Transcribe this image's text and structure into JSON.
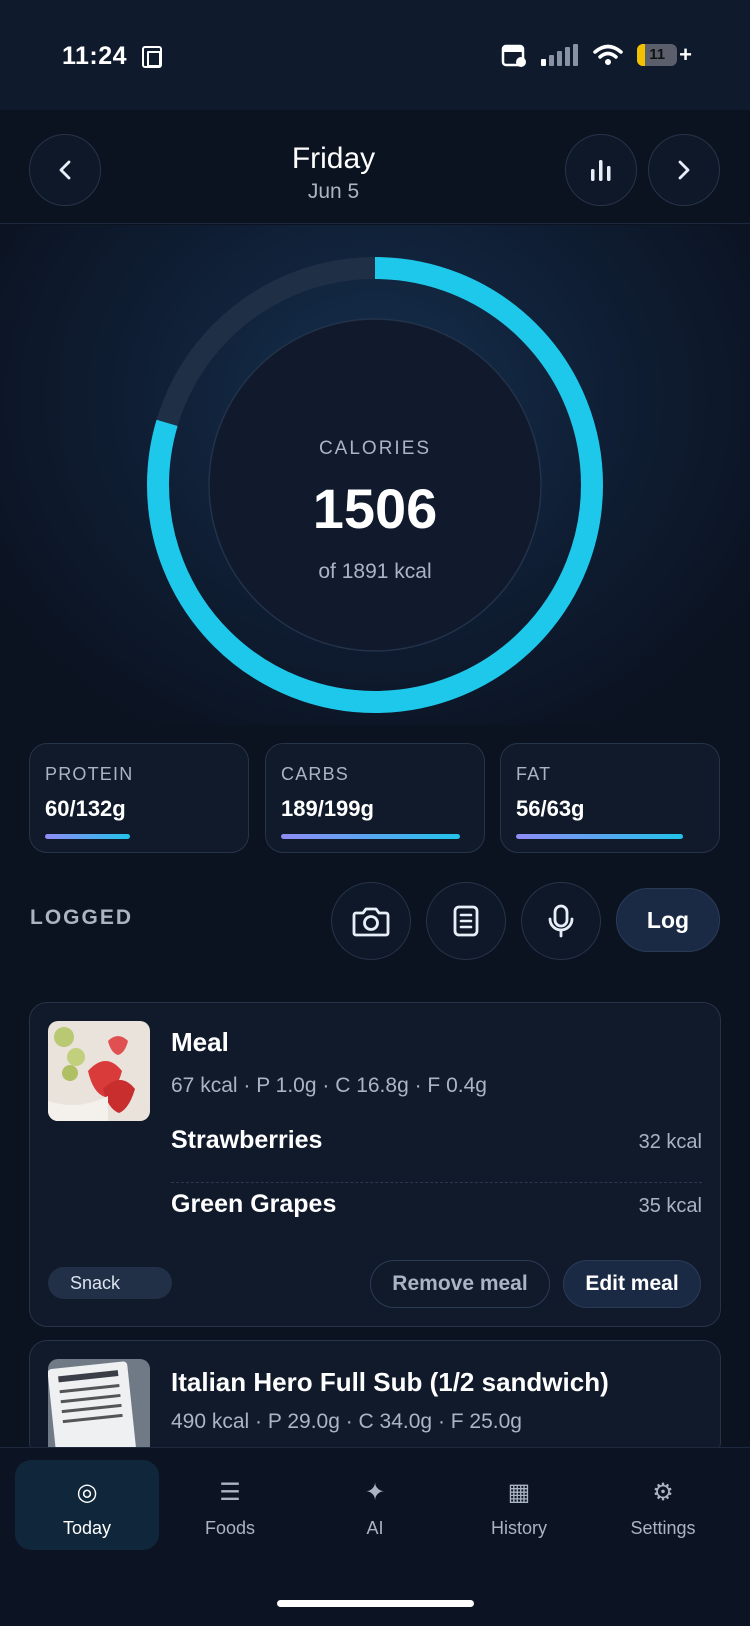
{
  "status_bar": {
    "time": "11:24",
    "battery": "11"
  },
  "header": {
    "day": "Friday",
    "date": "Jun 5",
    "prev_icon": "chevron-left-icon",
    "stats_icon": "bar-chart-icon",
    "next_icon": "chevron-right-icon"
  },
  "calories": {
    "label": "CALORIES",
    "value": "1506",
    "goal_text": "of 1891 kcal",
    "progress": 0.796,
    "accent": "#1ec8ea"
  },
  "macros": [
    {
      "label": "PROTEIN",
      "value": "60/132g",
      "progress": 0.45
    },
    {
      "label": "CARBS",
      "value": "189/199g",
      "progress": 0.95
    },
    {
      "label": "FAT",
      "value": "56/63g",
      "progress": 0.89
    }
  ],
  "logged": {
    "label": "LOGGED",
    "tools": [
      "camera-icon",
      "document-icon",
      "microphone-icon"
    ],
    "log_label": "Log"
  },
  "meals": [
    {
      "title": "Meal",
      "macros": "67 kcal · P 1.0g · C 16.8g · F 0.4g",
      "foods": [
        {
          "name": "Strawberries",
          "kcal": "32 kcal"
        },
        {
          "name": "Green Grapes",
          "kcal": "35 kcal"
        }
      ],
      "tag": "Snack",
      "remove_label": "Remove meal",
      "edit_label": "Edit meal"
    },
    {
      "title": "Italian Hero Full Sub (1/2 sandwich)",
      "macros": "490 kcal · P 29.0g · C 34.0g · F 25.0g"
    }
  ],
  "tabs": [
    {
      "label": "Today",
      "icon": "target-icon",
      "active": true
    },
    {
      "label": "Foods",
      "icon": "list-icon"
    },
    {
      "label": "AI",
      "icon": "sparkle-icon"
    },
    {
      "label": "History",
      "icon": "grid-icon"
    },
    {
      "label": "Settings",
      "icon": "gear-icon"
    }
  ]
}
